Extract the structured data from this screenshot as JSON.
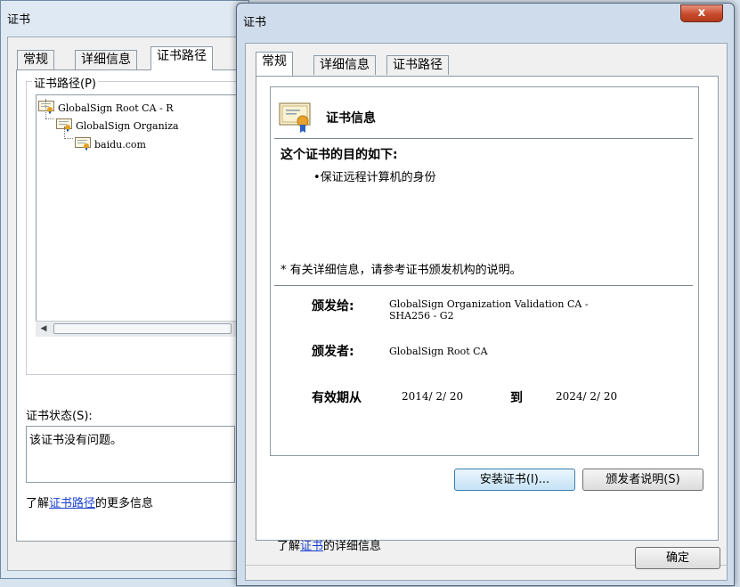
{
  "back_window": {
    "title": "证书",
    "tabs": [
      "常规",
      "详细信息",
      "证书路径"
    ],
    "active_tab_index": 2,
    "path_group_label": "证书路径(P)",
    "tree": [
      "GlobalSign Root CA - R",
      "GlobalSign Organiza",
      "baidu.com"
    ],
    "status_label": "证书状态(S):",
    "status_text": "该证书没有问题。",
    "learn_prefix": "了解",
    "learn_link": "证书路径",
    "learn_suffix": "的更多信息"
  },
  "front_window": {
    "title": "证书",
    "close_glyph": "x",
    "tabs": [
      "常规",
      "详细信息",
      "证书路径"
    ],
    "active_tab_index": 0,
    "info_heading": "证书信息",
    "purpose_heading": "这个证书的目的如下:",
    "purpose_items": [
      "保证远程计算机的身份"
    ],
    "note": "* 有关详细信息，请参考证书颁发机构的说明。",
    "issued_to_label": "颁发给:",
    "issued_to_value_line1": "GlobalSign Organization Validation CA -",
    "issued_to_value_line2": "SHA256 - G2",
    "issued_by_label": "颁发者:",
    "issued_by_value": "GlobalSign Root CA",
    "valid_from_label": "有效期从",
    "valid_from": "2014/ 2/ 20",
    "valid_to_label": "到",
    "valid_to": "2024/ 2/ 20",
    "install_button": "安装证书(I)...",
    "issuer_statement_button": "颁发者说明(S)",
    "learn_prefix": "了解",
    "learn_link": "证书",
    "learn_suffix": "的详细信息",
    "ok_button": "确定"
  },
  "colors": {
    "link": "#1a3fd1",
    "close_button": "#c84a2c",
    "window_frame": "#cfdceb"
  }
}
